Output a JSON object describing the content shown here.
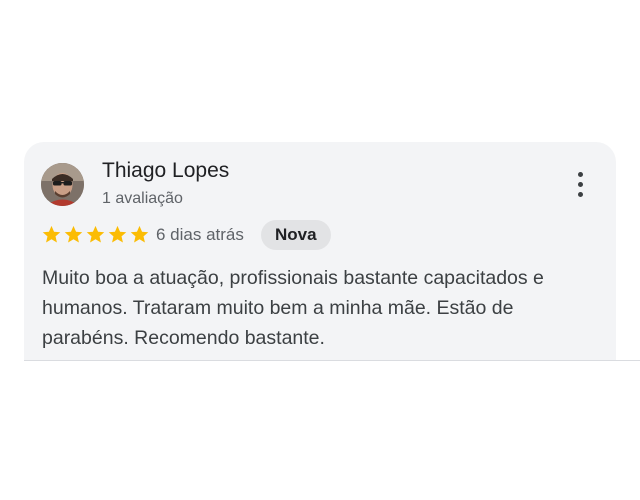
{
  "review": {
    "author_name": "Thiago Lopes",
    "author_meta": "1 avaliação",
    "rating": 5,
    "rating_max": 5,
    "date": "6 dias atrás",
    "badge": "Nova",
    "text": "Muito boa a atuação, profissionais bastante capacitados e humanos. Trataram muito bem a minha mãe. Estão de parabéns. Recomendo bastante."
  },
  "icons": {
    "menu": "more-vert-icon",
    "star": "star-icon",
    "avatar": "user-avatar"
  },
  "colors": {
    "star": "#fbbc04",
    "card_background": "#f3f4f6",
    "badge_background": "#e2e3e5",
    "text_primary": "#202124",
    "text_secondary": "#5f6368"
  }
}
